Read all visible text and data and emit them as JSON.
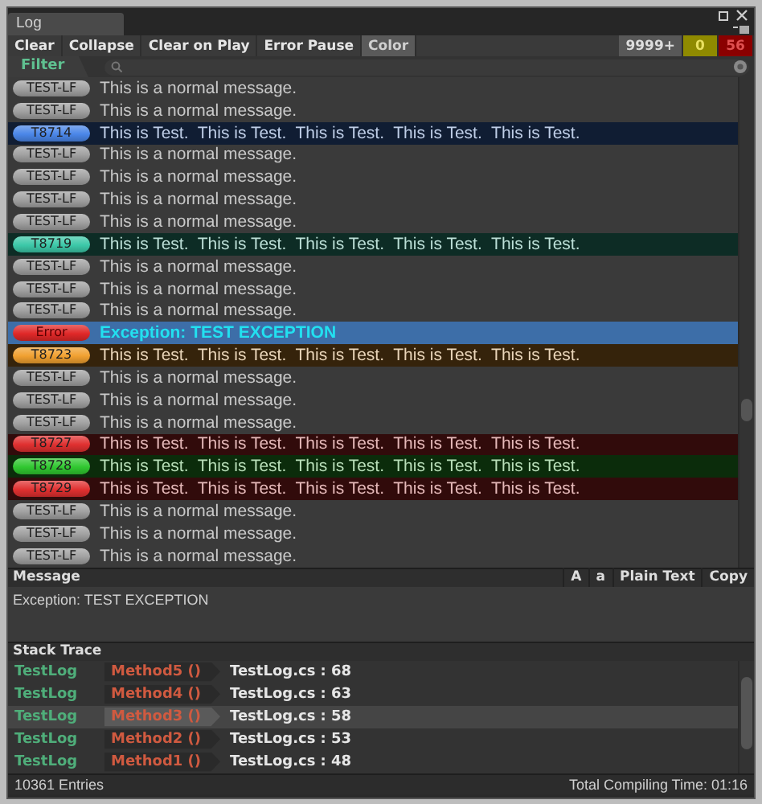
{
  "window": {
    "title": "Log"
  },
  "toolbar": {
    "buttons": [
      {
        "label": "Clear",
        "on": false
      },
      {
        "label": "Collapse",
        "on": false
      },
      {
        "label": "Clear on Play",
        "on": false
      },
      {
        "label": "Error Pause",
        "on": false
      },
      {
        "label": "Color",
        "on": true
      }
    ],
    "counters": [
      {
        "label": "9999+",
        "kind": "log"
      },
      {
        "label": "0",
        "kind": "warning"
      },
      {
        "label": "56",
        "kind": "error"
      }
    ]
  },
  "filter": {
    "label": "Filter"
  },
  "log_rows": [
    {
      "tag": "TEST-LF",
      "message": "This is a normal message.",
      "kind": "normal",
      "selected": false
    },
    {
      "tag": "TEST-LF",
      "message": "This is a normal message.",
      "kind": "normal",
      "selected": false
    },
    {
      "tag": "T8714",
      "message": "This is Test.  This is Test.  This is Test.  This is Test.  This is Test.",
      "kind": "test",
      "color": "#4a86e8",
      "selected": false
    },
    {
      "tag": "TEST-LF",
      "message": "This is a normal message.",
      "kind": "normal",
      "selected": false
    },
    {
      "tag": "TEST-LF",
      "message": "This is a normal message.",
      "kind": "normal",
      "selected": false
    },
    {
      "tag": "TEST-LF",
      "message": "This is a normal message.",
      "kind": "normal",
      "selected": false
    },
    {
      "tag": "TEST-LF",
      "message": "This is a normal message.",
      "kind": "normal",
      "selected": false
    },
    {
      "tag": "T8719",
      "message": "This is Test.  This is Test.  This is Test.  This is Test.  This is Test.",
      "kind": "test",
      "color": "#3cc8a8",
      "selected": false
    },
    {
      "tag": "TEST-LF",
      "message": "This is a normal message.",
      "kind": "normal",
      "selected": false
    },
    {
      "tag": "TEST-LF",
      "message": "This is a normal message.",
      "kind": "normal",
      "selected": false
    },
    {
      "tag": "TEST-LF",
      "message": "This is a normal message.",
      "kind": "normal",
      "selected": false
    },
    {
      "tag": "Error",
      "message": "Exception: TEST EXCEPTION",
      "kind": "error",
      "color": "#e02828",
      "selected": true
    },
    {
      "tag": "T8723",
      "message": "This is Test.  This is Test.  This is Test.  This is Test.  This is Test.",
      "kind": "test",
      "color": "#f0a030",
      "selected": false
    },
    {
      "tag": "TEST-LF",
      "message": "This is a normal message.",
      "kind": "normal",
      "selected": false
    },
    {
      "tag": "TEST-LF",
      "message": "This is a normal message.",
      "kind": "normal",
      "selected": false
    },
    {
      "tag": "TEST-LF",
      "message": "This is a normal message.",
      "kind": "normal",
      "selected": false
    },
    {
      "tag": "T8727",
      "message": "This is Test.  This is Test.  This is Test.  This is Test.  This is Test.",
      "kind": "test",
      "color": "#e03030",
      "selected": false
    },
    {
      "tag": "T8728",
      "message": "This is Test.  This is Test.  This is Test.  This is Test.  This is Test.",
      "kind": "test",
      "color": "#30c830",
      "selected": false
    },
    {
      "tag": "T8729",
      "message": "This is Test.  This is Test.  This is Test.  This is Test.  This is Test.",
      "kind": "test",
      "color": "#e03030",
      "selected": false
    },
    {
      "tag": "TEST-LF",
      "message": "This is a normal message.",
      "kind": "normal",
      "selected": false
    },
    {
      "tag": "TEST-LF",
      "message": "This is a normal message.",
      "kind": "normal",
      "selected": false
    },
    {
      "tag": "TEST-LF",
      "message": "This is a normal message.",
      "kind": "normal",
      "selected": false
    }
  ],
  "message_panel": {
    "title": "Message",
    "buttons": [
      "A",
      "a",
      "Plain Text",
      "Copy"
    ],
    "text": "Exception: TEST EXCEPTION"
  },
  "stack_trace": {
    "title": "Stack Trace",
    "frames": [
      {
        "class": "TestLog",
        "method": "Method5 ()",
        "location": "TestLog.cs : 68",
        "selected": false
      },
      {
        "class": "TestLog",
        "method": "Method4 ()",
        "location": "TestLog.cs : 63",
        "selected": false
      },
      {
        "class": "TestLog",
        "method": "Method3 ()",
        "location": "TestLog.cs : 58",
        "selected": true
      },
      {
        "class": "TestLog",
        "method": "Method2 ()",
        "location": "TestLog.cs : 53",
        "selected": false
      },
      {
        "class": "TestLog",
        "method": "Method1 ()",
        "location": "TestLog.cs : 48",
        "selected": false
      }
    ]
  },
  "status_bar": {
    "entries": "10361 Entries",
    "compile_time": "Total Compiling Time: 01:16"
  }
}
